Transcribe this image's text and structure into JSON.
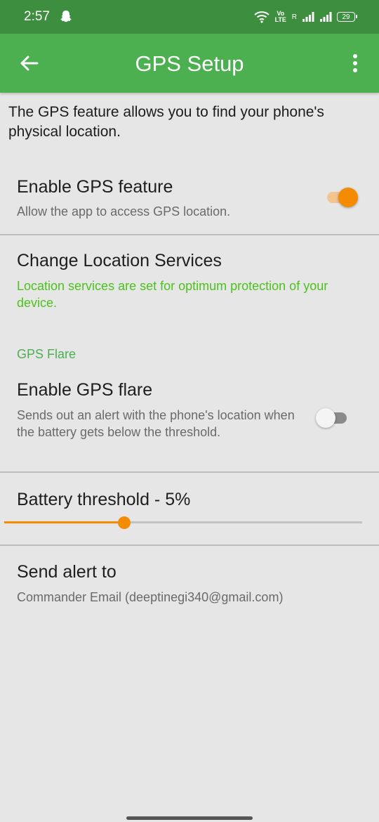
{
  "status_bar": {
    "time": "2:57",
    "network_label": "Vo LTE",
    "roaming_label": "R",
    "battery_level": "29"
  },
  "app_bar": {
    "title": "GPS Setup",
    "back_icon": "arrow-left-icon",
    "menu_icon": "more-vert-icon"
  },
  "intro_text": "The GPS feature allows you to find your phone's physical location.",
  "enable_gps": {
    "title": "Enable GPS feature",
    "subtitle": "Allow the app to access GPS location.",
    "enabled": true
  },
  "location_services": {
    "title": "Change Location Services",
    "subtitle": "Location services are set for optimum protection of your device."
  },
  "gps_flare_section": {
    "label": "GPS Flare"
  },
  "enable_flare": {
    "title": "Enable GPS flare",
    "subtitle": "Sends out an alert with the phone's location when the battery gets below the threshold.",
    "enabled": false
  },
  "battery_threshold": {
    "title": "Battery threshold - 5%",
    "slider_fraction": 0.335
  },
  "send_alert": {
    "title": "Send alert to",
    "subtitle": "Commander Email (deeptinegi340@gmail.com)"
  },
  "colors": {
    "status_bar": "#3d8f3f",
    "app_bar": "#4caf50",
    "accent_orange": "#f58b00",
    "accent_green_text": "#4cc21c",
    "background": "#e6e6e6"
  }
}
